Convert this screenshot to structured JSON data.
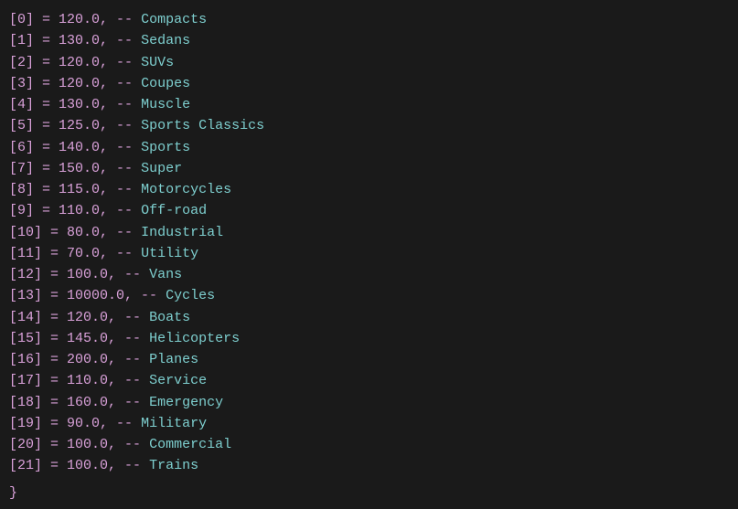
{
  "entries": [
    {
      "index": 0,
      "value": "120.0",
      "label": "Compacts"
    },
    {
      "index": 1,
      "value": "130.0",
      "label": "Sedans"
    },
    {
      "index": 2,
      "value": "120.0",
      "label": "SUVs"
    },
    {
      "index": 3,
      "value": "120.0",
      "label": "Coupes"
    },
    {
      "index": 4,
      "value": "130.0",
      "label": "Muscle"
    },
    {
      "index": 5,
      "value": "125.0",
      "label": "Sports Classics"
    },
    {
      "index": 6,
      "value": "140.0",
      "label": "Sports"
    },
    {
      "index": 7,
      "value": "150.0",
      "label": "Super"
    },
    {
      "index": 8,
      "value": "115.0",
      "label": "Motorcycles"
    },
    {
      "index": 9,
      "value": "110.0",
      "label": "Off-road"
    },
    {
      "index": 10,
      "value": "80.0",
      "label": "Industrial"
    },
    {
      "index": 11,
      "value": "70.0",
      "label": "Utility"
    },
    {
      "index": 12,
      "value": "100.0",
      "label": "Vans"
    },
    {
      "index": 13,
      "value": "10000.0",
      "label": "Cycles"
    },
    {
      "index": 14,
      "value": "120.0",
      "label": "Boats"
    },
    {
      "index": 15,
      "value": "145.0",
      "label": "Helicopters"
    },
    {
      "index": 16,
      "value": "200.0",
      "label": "Planes"
    },
    {
      "index": 17,
      "value": "110.0",
      "label": "Service"
    },
    {
      "index": 18,
      "value": "160.0",
      "label": "Emergency"
    },
    {
      "index": 19,
      "value": "90.0",
      "label": "Military"
    },
    {
      "index": 20,
      "value": "100.0",
      "label": "Commercial"
    },
    {
      "index": 21,
      "value": "100.0",
      "label": "Trains"
    }
  ],
  "closing_brace": "}"
}
